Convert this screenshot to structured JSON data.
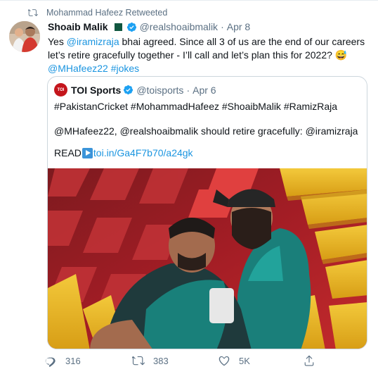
{
  "retweet": {
    "text": "Mohammad Hafeez Retweeted"
  },
  "tweet": {
    "name": "Shoaib Malik",
    "handle": "@realshoaibmalik",
    "separator": "·",
    "date": "Apr 8",
    "text_parts": [
      "Yes ",
      "@iramizraja",
      " bhai agreed. Since all 3 of us are the end of our careers let’s retire gracefully together - I’ll call and let’s plan this for 2022? 😅"
    ],
    "tags": [
      "@MHafeez22",
      "#jokes"
    ]
  },
  "quoted": {
    "logo_text": "TOI",
    "name": "TOI Sports",
    "handle": "@toisports",
    "separator": "·",
    "date": "Apr 6",
    "hashtags": "#PakistanCricket #MohammadHafeez #ShoaibMalik #RamizRaja",
    "line2": "@MHafeez22, @realshoaibmalik should retire gracefully: @iramizraja",
    "read_label": "READ",
    "link": "toi.in/Ga4F7b70/a24gk"
  },
  "actions": {
    "reply_count": "316",
    "retweet_count": "383",
    "like_count": "5K"
  },
  "colors": {
    "link": "#1b95e0",
    "secondary": "#5b7083",
    "verified": "#1da1f2"
  }
}
